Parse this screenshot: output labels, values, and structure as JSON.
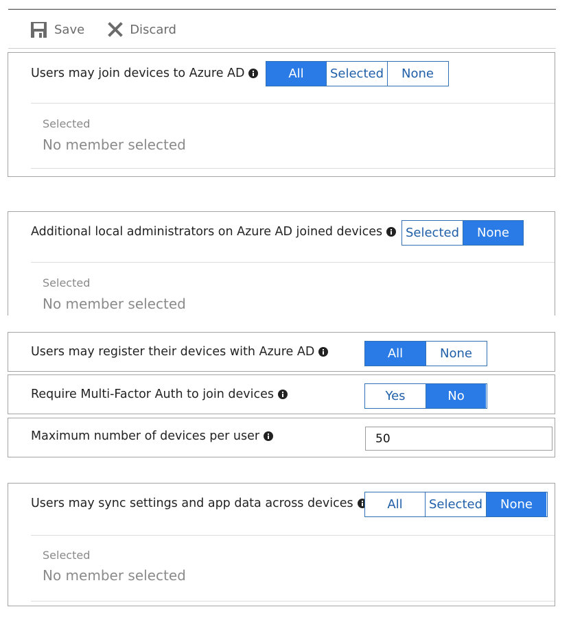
{
  "toolbar": {
    "save_label": "Save",
    "discard_label": "Discard"
  },
  "sections": {
    "join": {
      "label": "Users may join devices to Azure AD",
      "options": [
        "All",
        "Selected",
        "None"
      ],
      "active": "All",
      "selected_caption": "Selected",
      "selected_value": "No member selected"
    },
    "admins": {
      "label": "Additional local administrators on Azure AD joined devices",
      "options": [
        "Selected",
        "None"
      ],
      "active": "None",
      "selected_caption": "Selected",
      "selected_value": "No member selected"
    },
    "register": {
      "label": "Users may register their devices with Azure AD",
      "options": [
        "All",
        "None"
      ],
      "active": "All"
    },
    "mfa": {
      "label": "Require Multi-Factor Auth to join devices",
      "options": [
        "Yes",
        "No"
      ],
      "active": "No"
    },
    "maxdev": {
      "label": "Maximum number of devices per user",
      "value": "50"
    },
    "sync": {
      "label": "Users may sync settings and app data across devices",
      "options": [
        "All",
        "Selected",
        "None"
      ],
      "active": "None",
      "selected_caption": "Selected",
      "selected_value": "No member selected"
    }
  },
  "colors": {
    "accent": "#2b7be6",
    "border_accent": "#2f6fb5",
    "muted_text": "#8a8a8a"
  },
  "icons": {
    "save": "save-icon",
    "discard": "close-icon",
    "info": "info-icon"
  }
}
